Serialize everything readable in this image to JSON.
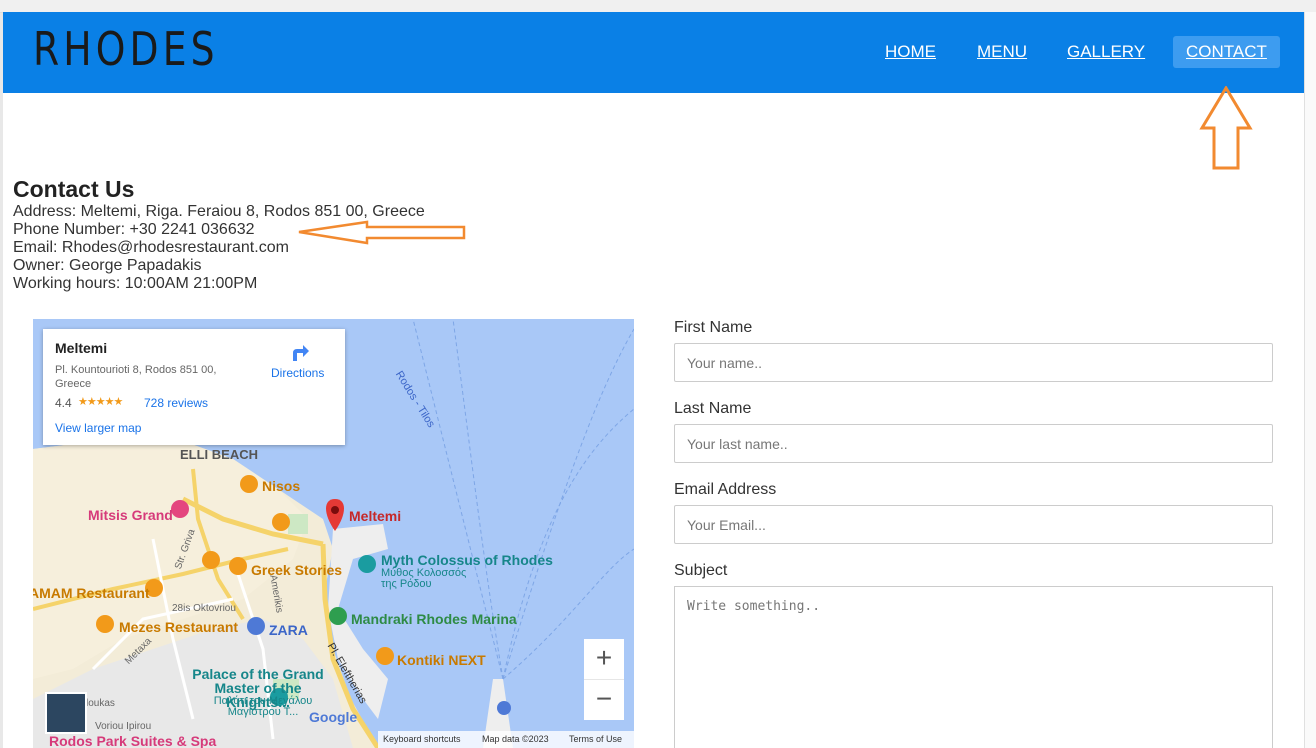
{
  "header": {
    "logo": "RHODES",
    "nav": [
      {
        "label": "HOME"
      },
      {
        "label": "MENU"
      },
      {
        "label": "GALLERY"
      },
      {
        "label": "CONTACT"
      }
    ]
  },
  "contact": {
    "heading": "Contact Us",
    "address": "Address: Meltemi, Riga. Feraiou 8, Rodos 851 00, Greece",
    "phone": "Phone Number: +30 2241 036632",
    "email": "Email: Rhodes@rhodesrestaurant.com",
    "owner": "Owner: George Papadakis",
    "hours": "Working hours: 10:00AM 21:00PM"
  },
  "map": {
    "place_name": "Meltemi",
    "place_address": "Pl. Kountourioti 8, Rodos 851 00, Greece",
    "rating": "4.4",
    "stars": "★★★★★",
    "reviews": "728 reviews",
    "directions": "Directions",
    "view_larger": "View larger map",
    "labels": {
      "elli_beach": "ELLI BEACH",
      "nisos": "Nisos",
      "meltemi": "Meltemi",
      "mitsis": "Mitsis Grand",
      "greek_stories": "Greek Stories",
      "colossus": "Myth Colossus of Rhodes",
      "colossus_gr": "Μύθος Κολοσσός της Ρόδου",
      "amam": "AMAM Restaurant",
      "mandraki": "Mandraki Rhodes Marina",
      "mezes": "Mezes Restaurant",
      "zara": "ZARA",
      "kontiki": "Kontiki NEXT",
      "palace": "Palace of the Grand Master of the Knights...",
      "palace_gr": "Παλάτι του Μεγάλου Μαγίστρου Τ...",
      "parks": "Rodos Park Suites & Spa",
      "route": "Rodos - Tilos",
      "street1": "Str. Griva",
      "street2": "28is Oktovriou",
      "street3": "Amerikis",
      "street4": "Pl. Eleftherias",
      "street5": "Metaxa",
      "street6": "Voriou Ipirou",
      "street7": "loukas",
      "google": "Google",
      "shortcuts": "Keyboard shortcuts",
      "map_data": "Map data ©2023",
      "terms": "Terms of Use"
    }
  },
  "form": {
    "first_name_label": "First Name",
    "first_name_placeholder": "Your name..",
    "last_name_label": "Last Name",
    "last_name_placeholder": "Your last name..",
    "email_label": "Email Address",
    "email_placeholder": "Your Email...",
    "subject_label": "Subject",
    "subject_placeholder": "Write something.."
  },
  "colors": {
    "header_bg": "#0a80e6",
    "annotation": "#f28a30"
  }
}
